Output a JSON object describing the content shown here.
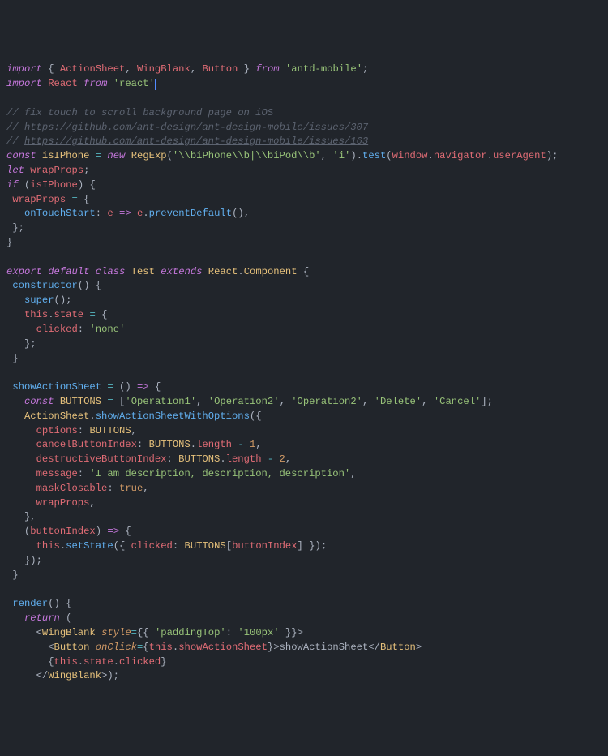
{
  "code": {
    "line1": {
      "import": "import",
      "lb": "{",
      "ActionSheet": "ActionSheet",
      "c1": ",",
      "WingBlank": "WingBlank",
      "c2": ",",
      "Button": "Button",
      "rb": "}",
      "from": "from",
      "mod": "'antd-mobile'",
      "semi": ";"
    },
    "line2": {
      "import": "import",
      "React": "React",
      "from": "from",
      "mod": "'react'"
    },
    "comments": {
      "c1": "// fix touch to scroll background page on iOS",
      "c2p": "// ",
      "c2u": "https://github.com/ant-design/ant-design-mobile/issues/307",
      "c3p": "// ",
      "c3u": "https://github.com/ant-design/ant-design-mobile/issues/163"
    },
    "isIPhone": {
      "const": "const",
      "name": "isIPhone",
      "eq": "=",
      "new": "new",
      "RegExp": "RegExp",
      "lp": "(",
      "regex": "'\\\\biPhone\\\\b|\\\\biPod\\\\b'",
      "c": ",",
      "flag": "'i'",
      "rp": ")",
      "dot": ".",
      "test": "test",
      "lp2": "(",
      "window": "window",
      "dot2": ".",
      "navigator": "navigator",
      "dot3": ".",
      "userAgent": "userAgent",
      "rp2": ")",
      "semi": ";"
    },
    "letWrap": {
      "let": "let",
      "name": "wrapProps",
      "semi": ";"
    },
    "if": {
      "if": "if",
      "lp": "(",
      "cond": "isIPhone",
      "rp": ")",
      "lb": "{"
    },
    "assignWrap": {
      "name": "wrapProps",
      "eq": "=",
      "lb": "{"
    },
    "onTouch": {
      "prop": "onTouchStart",
      "colon": ":",
      "e": "e",
      "arrow": "=>",
      "e2": "e",
      "dot": ".",
      "fn": "preventDefault",
      "call": "()",
      "comma": ","
    },
    "closeObj": {
      "rb": "};"
    },
    "closeIf": {
      "rb": "}"
    },
    "exportLine": {
      "export": "export",
      "default": "default",
      "class": "class",
      "Test": "Test",
      "extends": "extends",
      "React": "React",
      "dot": ".",
      "Component": "Component",
      "lb": "{"
    },
    "ctor": {
      "name": "constructor",
      "paren": "()",
      "lb": "{"
    },
    "super": {
      "fn": "super",
      "call": "()",
      "semi": ";"
    },
    "thisState": {
      "this": "this",
      "dot": ".",
      "state": "state",
      "eq": "=",
      "lb": "{"
    },
    "clicked": {
      "key": "clicked",
      "colon": ":",
      "val": "'none'"
    },
    "closeState": {
      "rb": "};"
    },
    "closeCtor": {
      "rb": "}"
    },
    "showSheet": {
      "name": "showActionSheet",
      "eq": "=",
      "paren": "()",
      "arrow": "=>",
      "lb": "{"
    },
    "buttons": {
      "const": "const",
      "name": "BUTTONS",
      "eq": "=",
      "lb": "[",
      "v1": "'Operation1'",
      "c1": ",",
      "v2": "'Operation2'",
      "c2": ",",
      "v3": "'Operation2'",
      "c3": ",",
      "v4": "'Delete'",
      "c4": ",",
      "v5": "'Cancel'",
      "rb": "]",
      "semi": ";"
    },
    "asCall": {
      "ActionSheet": "ActionSheet",
      "dot": ".",
      "fn": "showActionSheetWithOptions",
      "lp": "(",
      "lb": "{"
    },
    "opt1": {
      "key": "options",
      "colon": ":",
      "val": "BUTTONS",
      "comma": ","
    },
    "opt2": {
      "key": "cancelButtonIndex",
      "colon": ":",
      "v": "BUTTONS",
      "dot": ".",
      "len": "length",
      "minus": "-",
      "n": "1",
      "comma": ","
    },
    "opt3": {
      "key": "destructiveButtonIndex",
      "colon": ":",
      "v": "BUTTONS",
      "dot": ".",
      "len": "length",
      "minus": "-",
      "n": "2",
      "comma": ","
    },
    "opt4": {
      "key": "message",
      "colon": ":",
      "val": "'I am description, description, description'",
      "comma": ","
    },
    "opt5": {
      "key": "maskClosable",
      "colon": ":",
      "val": "true",
      "comma": ","
    },
    "opt6": {
      "key": "wrapProps",
      "comma": ","
    },
    "closeOpts": {
      "rb": "},"
    },
    "cb": {
      "lp": "(",
      "arg": "buttonIndex",
      "rp": ")",
      "arrow": "=>",
      "lb": "{"
    },
    "setState": {
      "this": "this",
      "dot": ".",
      "fn": "setState",
      "lp": "(",
      "lb": "{",
      "key": "clicked",
      "colon": ":",
      "v": "BUTTONS",
      "lbr": "[",
      "idx": "buttonIndex",
      "rbr": "]",
      "rb": "}",
      "rp": ")",
      "semi": ";"
    },
    "closeCb": {
      "rb": "});"
    },
    "closeShow": {
      "rb": "}"
    },
    "render": {
      "name": "render",
      "paren": "()",
      "lb": "{"
    },
    "return": {
      "kw": "return",
      "lp": "("
    },
    "jsx1": {
      "lt": "<",
      "tag": "WingBlank",
      "attr": "style",
      "eq": "=",
      "lb1": "{",
      "lb2": "{",
      "key": "'paddingTop'",
      "colon": ":",
      "val": "'100px'",
      "rb2": "}",
      "rb1": "}",
      "gt": ">"
    },
    "jsx2": {
      "lt": "<",
      "tag": "Button",
      "attr": "onClick",
      "eq": "=",
      "lb": "{",
      "this": "this",
      "dot": ".",
      "fn": "showActionSheet",
      "rb": "}",
      "gt": ">",
      "text": "showActionSheet",
      "lt2": "</",
      "tag2": "Button",
      "gt2": ">"
    },
    "jsx3": {
      "lb": "{",
      "this": "this",
      "dot": ".",
      "state": "state",
      "dot2": ".",
      "clicked": "clicked",
      "rb": "}"
    },
    "jsx4": {
      "lt": "</",
      "tag": "WingBlank",
      "gt": ">",
      "rp": ");"
    }
  },
  "chart_data": null
}
